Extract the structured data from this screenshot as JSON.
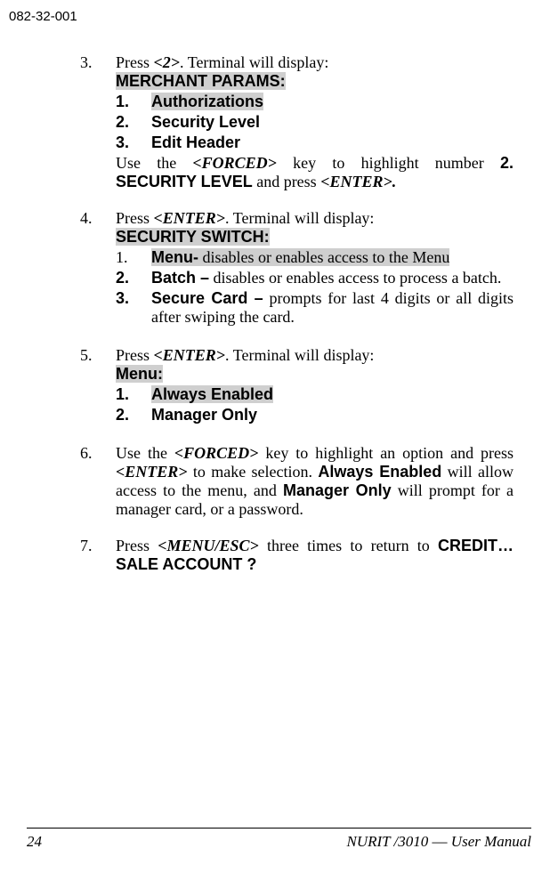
{
  "doc_id": "082-32-001",
  "steps": {
    "s3": {
      "num": "3.",
      "lead1a": "Press ",
      "lead1b": "<2>",
      "lead1c": ". Terminal will display:",
      "header": "MERCHANT PARAMS:",
      "items": [
        {
          "n": "1.",
          "label": "Authorizations"
        },
        {
          "n": "2.",
          "label": "Security Level"
        },
        {
          "n": "3.",
          "label": "Edit Header"
        }
      ],
      "tail1a": "Use the ",
      "tail1b": "<FORCED>",
      "tail1c": " key to highlight number ",
      "tail1d": "2. SECURITY LEVEL",
      "tail1e": " and press ",
      "tail1f": "<ENTER>."
    },
    "s4": {
      "num": "4.",
      "lead1a": "Press ",
      "lead1b": "<ENTER>",
      "lead1c": ". Terminal will display:",
      "header": "SECURITY SWITCH:",
      "items": [
        {
          "n": "1.",
          "label": "Menu-",
          "rest": " disables or enables access to the Menu"
        },
        {
          "n": "2.",
          "label": "Batch –",
          "rest": " disables or enables access to process a batch."
        },
        {
          "n": "3.",
          "label": "Secure Card –",
          "rest": " prompts for last 4 digits or all digits after swiping the card."
        }
      ]
    },
    "s5": {
      "num": "5.",
      "lead1a": "Press ",
      "lead1b": "<ENTER>",
      "lead1c": ". Terminal will display:",
      "header": "Menu:",
      "items": [
        {
          "n": "1.",
          "label": "Always Enabled"
        },
        {
          "n": "2.",
          "label": "Manager Only"
        }
      ]
    },
    "s6": {
      "num": "6.",
      "t1": "Use the ",
      "t2": "<FORCED>",
      "t3": " key to highlight an option and press ",
      "t4": "<ENTER>",
      "t5": " to make selection.  ",
      "t6": "Always Enabled",
      "t7": " will allow access to the menu, and ",
      "t8": "Manager Only",
      "t9": " will prompt for a manager card, or a password."
    },
    "s7": {
      "num": "7.",
      "t1": "Press ",
      "t2": "<MENU/ESC>",
      "t3": " three times to return to ",
      "t4": "CREDIT…SALE  ACCOUNT ?"
    }
  },
  "footer": {
    "page": "24",
    "product": "NURIT /3010",
    "dash": " — ",
    "suffix": "User Manual"
  }
}
